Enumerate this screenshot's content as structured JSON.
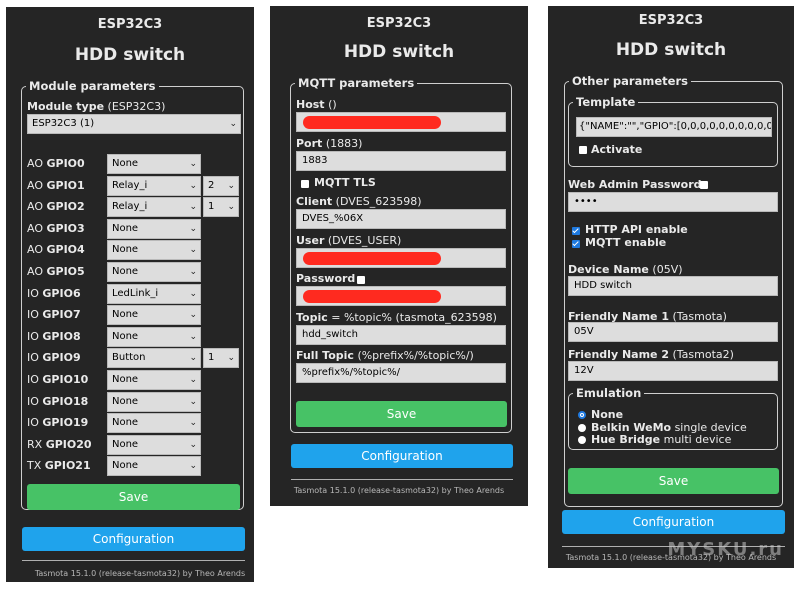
{
  "colors": {
    "panel_bg": "#252525",
    "input_bg": "#dddddd",
    "save_green": "#47c266",
    "config_blue": "#1fa3ec",
    "redaction_red": "#ff2a1f"
  },
  "panel1": {
    "device": "ESP32C3",
    "title": "HDD switch",
    "legend": "Module parameters",
    "module_type_label": "Module type",
    "module_type_hint": "(ESP32C3)",
    "module_type_value": "ESP32C3 (1)",
    "gpios": [
      {
        "prefix": "AO",
        "name": "GPIO0",
        "value": "None",
        "index": ""
      },
      {
        "prefix": "AO",
        "name": "GPIO1",
        "value": "Relay_i",
        "index": "2"
      },
      {
        "prefix": "AO",
        "name": "GPIO2",
        "value": "Relay_i",
        "index": "1"
      },
      {
        "prefix": "AO",
        "name": "GPIO3",
        "value": "None",
        "index": ""
      },
      {
        "prefix": "AO",
        "name": "GPIO4",
        "value": "None",
        "index": ""
      },
      {
        "prefix": "AO",
        "name": "GPIO5",
        "value": "None",
        "index": ""
      },
      {
        "prefix": "IO",
        "name": "GPIO6",
        "value": "LedLink_i",
        "index": ""
      },
      {
        "prefix": "IO",
        "name": "GPIO7",
        "value": "None",
        "index": ""
      },
      {
        "prefix": "IO",
        "name": "GPIO8",
        "value": "None",
        "index": ""
      },
      {
        "prefix": "IO",
        "name": "GPIO9",
        "value": "Button",
        "index": "1"
      },
      {
        "prefix": "IO",
        "name": "GPIO10",
        "value": "None",
        "index": ""
      },
      {
        "prefix": "IO",
        "name": "GPIO18",
        "value": "None",
        "index": ""
      },
      {
        "prefix": "IO",
        "name": "GPIO19",
        "value": "None",
        "index": ""
      },
      {
        "prefix": "RX",
        "name": "GPIO20",
        "value": "None",
        "index": ""
      },
      {
        "prefix": "TX",
        "name": "GPIO21",
        "value": "None",
        "index": ""
      }
    ],
    "save_label": "Save",
    "config_label": "Configuration",
    "footer": "Tasmota 15.1.0 (release-tasmota32) by Theo Arends"
  },
  "panel2": {
    "device": "ESP32C3",
    "title": "HDD switch",
    "legend": "MQTT parameters",
    "host_label": "Host",
    "host_hint": "()",
    "port_label": "Port",
    "port_hint": "(1883)",
    "port_value": "1883",
    "mqtt_tls_label": "MQTT TLS",
    "client_label": "Client",
    "client_hint": "(DVES_623598)",
    "client_value": "DVES_%06X",
    "user_label": "User",
    "user_hint": "(DVES_USER)",
    "password_label": "Password",
    "topic_label": "Topic",
    "topic_hint": "= %topic% (tasmota_623598)",
    "topic_value": "hdd_switch",
    "full_topic_label": "Full Topic",
    "full_topic_hint": "(%prefix%/%topic%/)",
    "full_topic_value": "%prefix%/%topic%/",
    "save_label": "Save",
    "config_label": "Configuration",
    "footer": "Tasmota 15.1.0 (release-tasmota32) by Theo Arends"
  },
  "panel3": {
    "device": "ESP32C3",
    "title": "HDD switch",
    "legend": "Other parameters",
    "template_legend": "Template",
    "template_value": "{\"NAME\":\"\",\"GPIO\":[0,0,0,0,0,0,0,0,0,0,",
    "activate_label": "Activate",
    "web_admin_label": "Web Admin Password",
    "web_admin_value": "••••",
    "http_api_label": "HTTP API enable",
    "mqtt_enable_label": "MQTT enable",
    "device_name_label": "Device Name",
    "device_name_hint": "(05V)",
    "device_name_value": "HDD switch",
    "friendly1_label": "Friendly Name 1",
    "friendly1_hint": "(Tasmota)",
    "friendly1_value": "05V",
    "friendly2_label": "Friendly Name 2",
    "friendly2_hint": "(Tasmota2)",
    "friendly2_value": "12V",
    "emulation_legend": "Emulation",
    "emulation_options": [
      {
        "bold": "None",
        "rest": "",
        "selected": true
      },
      {
        "bold": "Belkin WeMo",
        "rest": "single device",
        "selected": false
      },
      {
        "bold": "Hue Bridge",
        "rest": "multi device",
        "selected": false
      }
    ],
    "save_label": "Save",
    "config_label": "Configuration",
    "footer": "Tasmota 15.1.0 (release-tasmota32) by Theo Arends",
    "watermark": "MYSKU.ru"
  }
}
